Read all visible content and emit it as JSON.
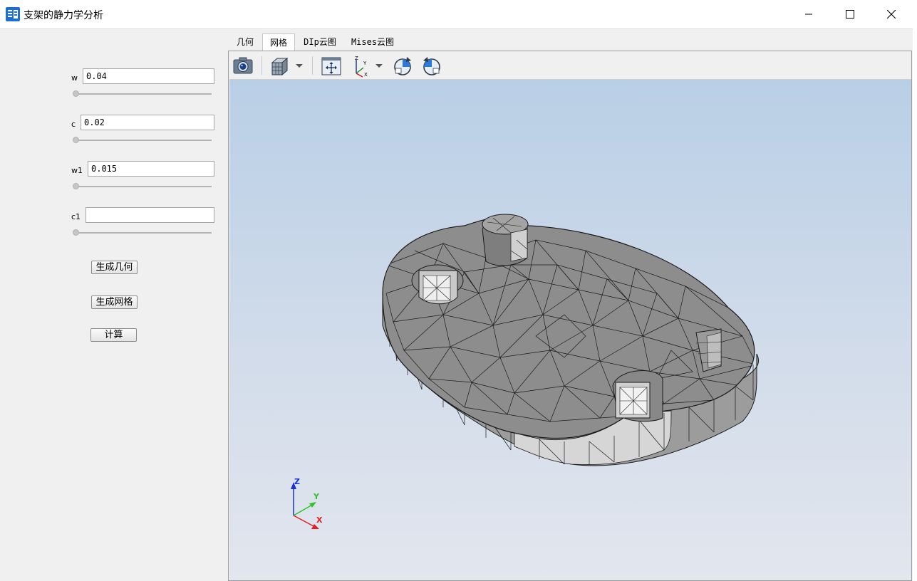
{
  "window": {
    "title": "支架的静力学分析",
    "minimize_icon": "minimize-icon",
    "maximize_icon": "maximize-icon",
    "close_icon": "close-icon"
  },
  "params": [
    {
      "label": "w",
      "value": "0.04",
      "slider": 0
    },
    {
      "label": "c",
      "value": "0.02",
      "slider": 0
    },
    {
      "label": "w1",
      "value": "0.015",
      "slider": 0
    },
    {
      "label": "c1",
      "value": "",
      "slider": 0
    }
  ],
  "buttons": {
    "gen_geometry": "生成几何",
    "gen_mesh": "生成网格",
    "compute": "计算"
  },
  "tabs": [
    {
      "label": "几何",
      "active": false
    },
    {
      "label": "网格",
      "active": true
    },
    {
      "label": "DIp云图",
      "active": false
    },
    {
      "label": "Mises云图",
      "active": false
    }
  ],
  "toolbar": {
    "icons": [
      "camera-icon",
      "cube-view-icon",
      "fit-view-icon",
      "axes-icon",
      "rotate-cw-icon",
      "rotate-ccw-icon"
    ]
  },
  "axes_triad": {
    "x": "X",
    "y": "Y",
    "z": "Z"
  },
  "colors": {
    "mesh_fill": "#8d8d8d",
    "mesh_edge": "#1a1a1a",
    "axis_x": "#e02020",
    "axis_y": "#2bc42b",
    "axis_z": "#1a2fd6"
  }
}
